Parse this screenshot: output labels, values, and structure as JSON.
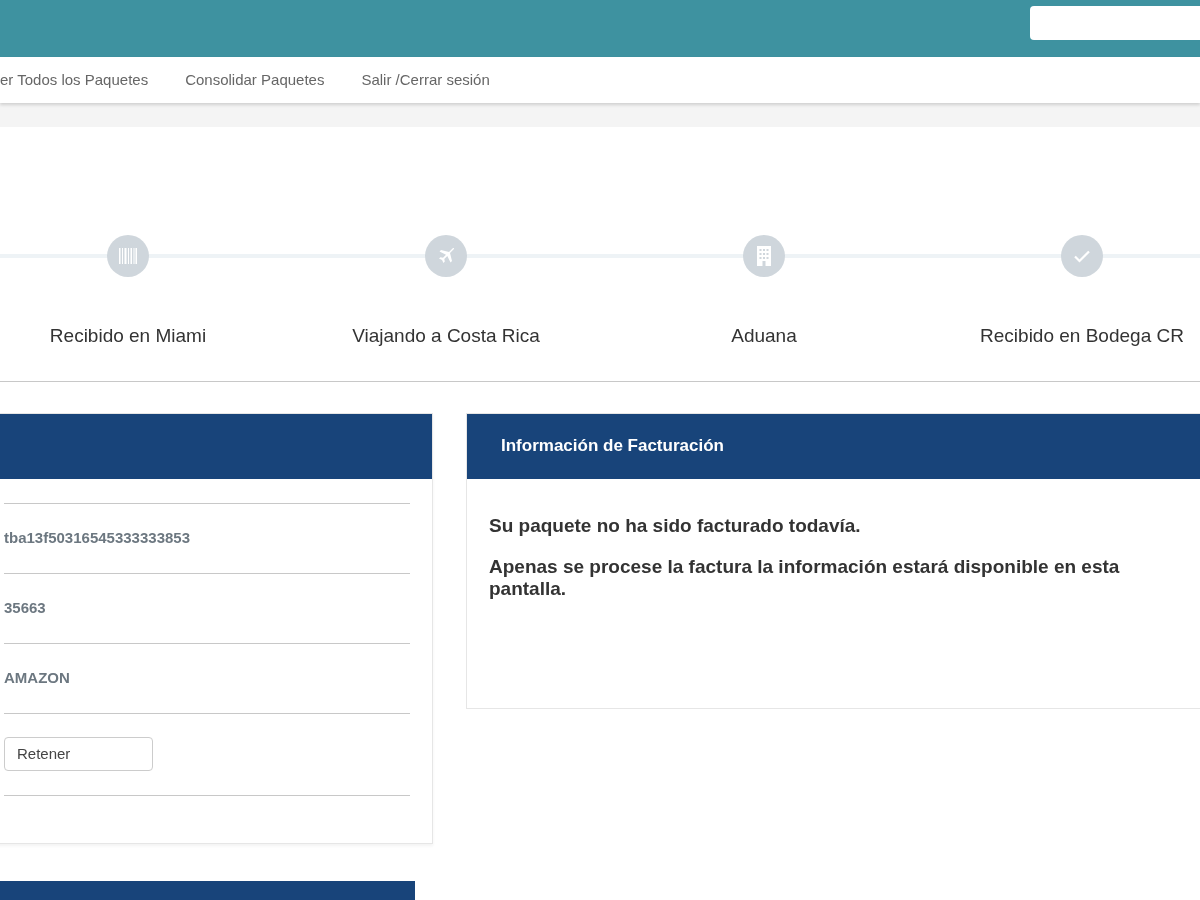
{
  "nav": {
    "links": [
      "er Todos los Paquetes",
      "Consolidar Paquetes",
      "Salir /Cerrar sesión"
    ]
  },
  "steps": [
    {
      "kind": "barcode",
      "label": "Recibido en Miami"
    },
    {
      "kind": "plane",
      "label": "Viajando a Costa Rica"
    },
    {
      "kind": "building",
      "label": "Aduana"
    },
    {
      "kind": "check",
      "label": "Recibido en Bodega CR"
    }
  ],
  "package_card": {
    "rows": [
      {
        "kind": "text",
        "value": "tba13f50316545333333853"
      },
      {
        "kind": "text",
        "value": "35663"
      },
      {
        "kind": "text",
        "value": "AMAZON"
      },
      {
        "kind": "button",
        "value": "Retener"
      }
    ]
  },
  "billing_card": {
    "title": "Información de Facturación",
    "messages": [
      "Su paquete no ha sido facturado todavía.",
      "Apenas se procese la factura la información estará disponible en esta pantalla."
    ]
  }
}
